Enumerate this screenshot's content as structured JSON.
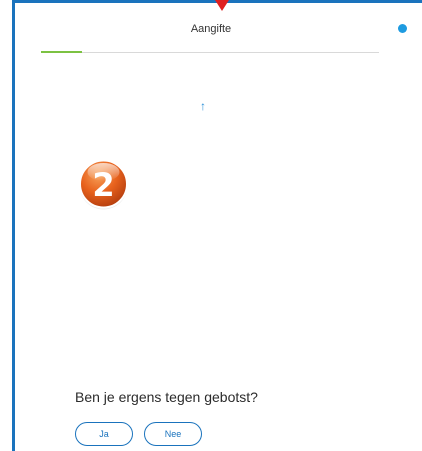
{
  "header": {
    "title": "Aangifte",
    "close_symbol": "×"
  },
  "progress": {
    "fraction": 0.12,
    "color": "#7cc242"
  },
  "content": {
    "arrow_symbol": "↑",
    "step_number": "2",
    "question": "Ben je ergens tegen gebotst?"
  },
  "answers": {
    "yes_label": "Ja",
    "no_label": "Nee"
  },
  "colors": {
    "accent": "#1a73bd",
    "badge": "#e8621d",
    "marker": "#e02020",
    "status_dot": "#1e9be0"
  },
  "icons": {
    "close": "close-icon",
    "status": "status-dot-icon",
    "marker": "triangle-down-marker-icon",
    "arrow": "arrow-up-icon"
  }
}
